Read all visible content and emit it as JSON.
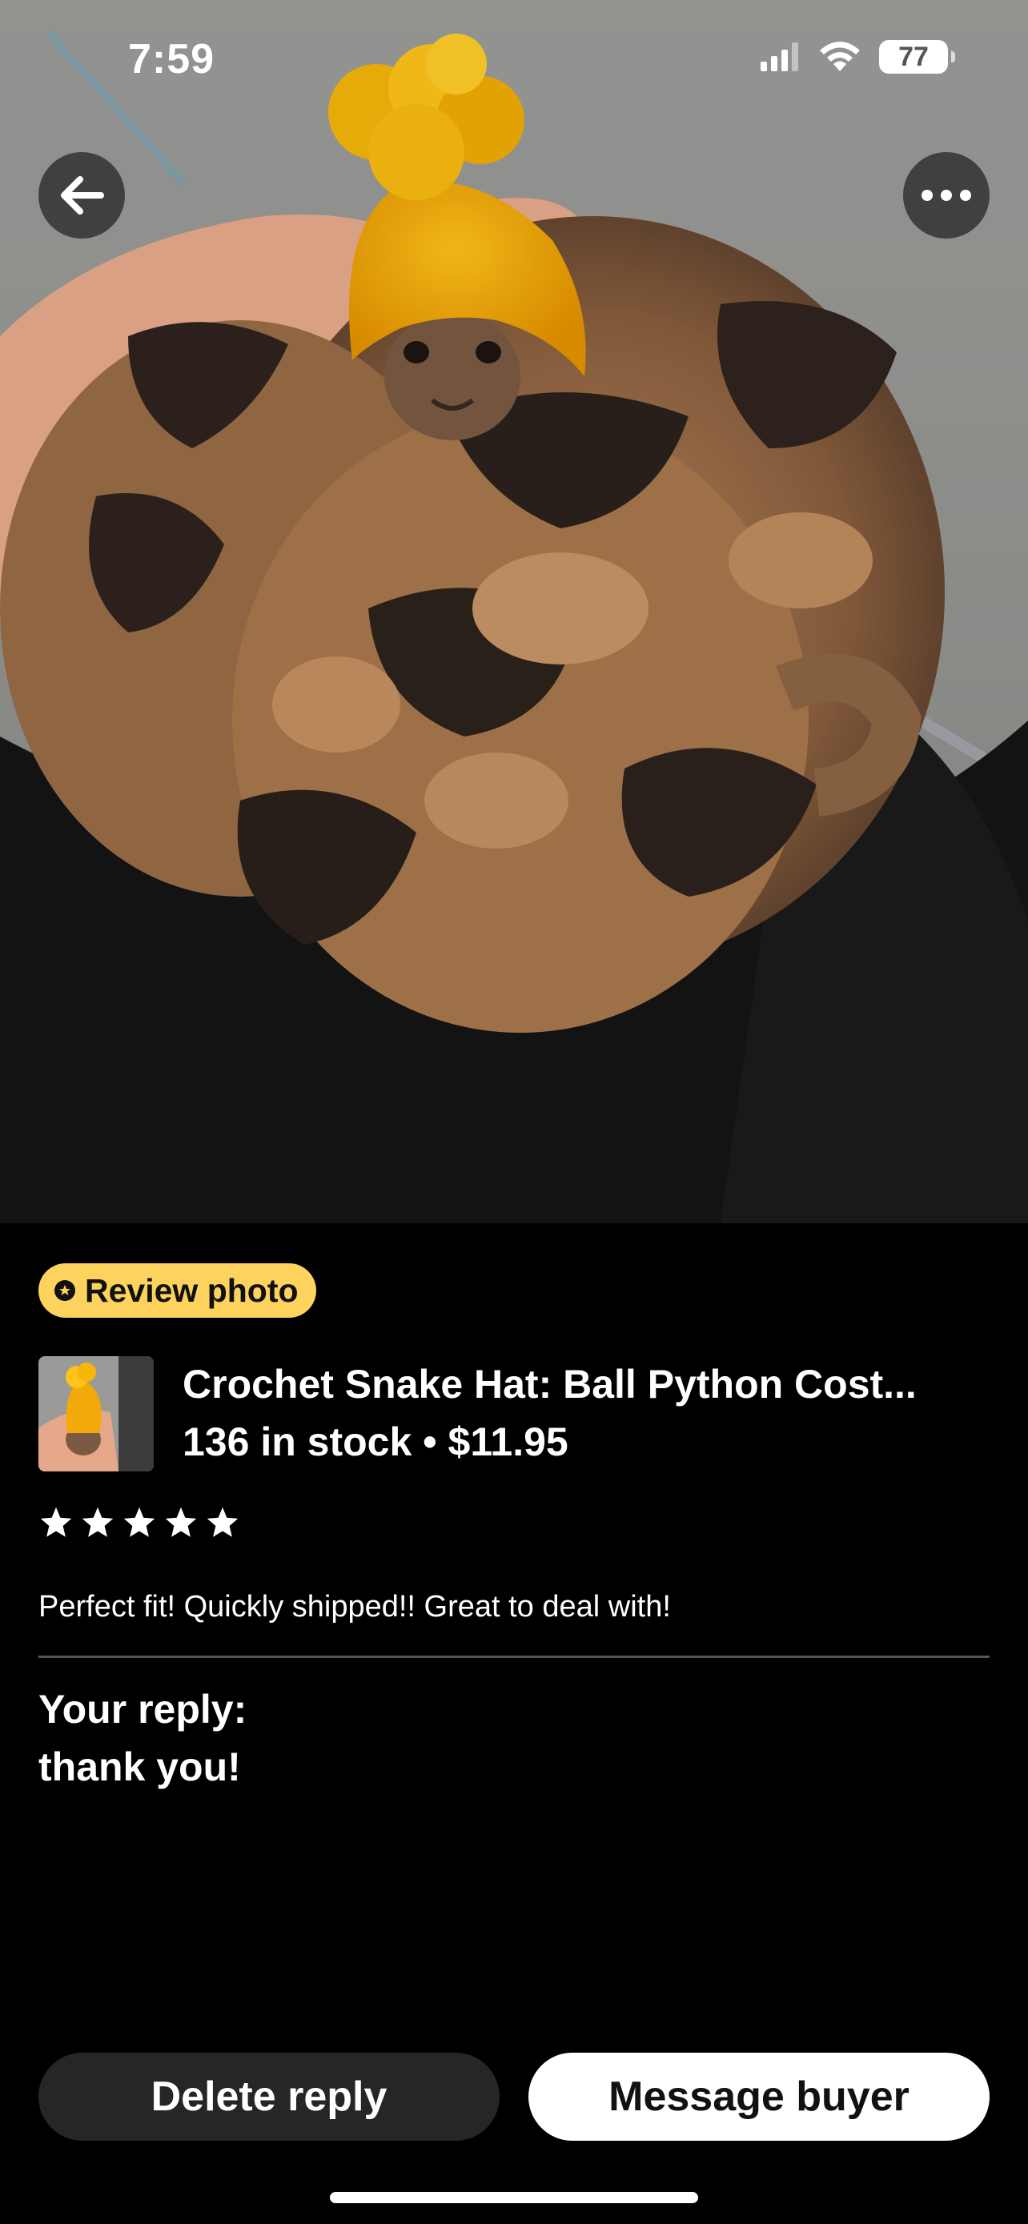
{
  "status_bar": {
    "time": "7:59",
    "battery": "77",
    "icons": [
      "cellular-signal-icon",
      "wifi-icon",
      "battery-icon"
    ]
  },
  "photo": {
    "description_icon": "review-photo-image"
  },
  "nav": {
    "back_icon": "arrow-left-icon",
    "more_icon": "ellipsis-icon"
  },
  "badge": {
    "label": "Review photo",
    "color": "#fdd35e"
  },
  "product": {
    "title": "Crochet Snake Hat: Ball Python Cost...",
    "meta": "136 in stock • $11.95"
  },
  "review": {
    "rating": 5,
    "max_rating": 5,
    "text": "Perfect fit! Quickly shipped!! Great to deal with!"
  },
  "reply": {
    "label": "Your reply:",
    "text": "thank you!"
  },
  "actions": {
    "delete_label": "Delete reply",
    "message_label": "Message buyer"
  },
  "colors": {
    "background": "#000000",
    "accent": "#fdd35e",
    "secondary_button": "#262626",
    "primary_button": "#ffffff"
  }
}
